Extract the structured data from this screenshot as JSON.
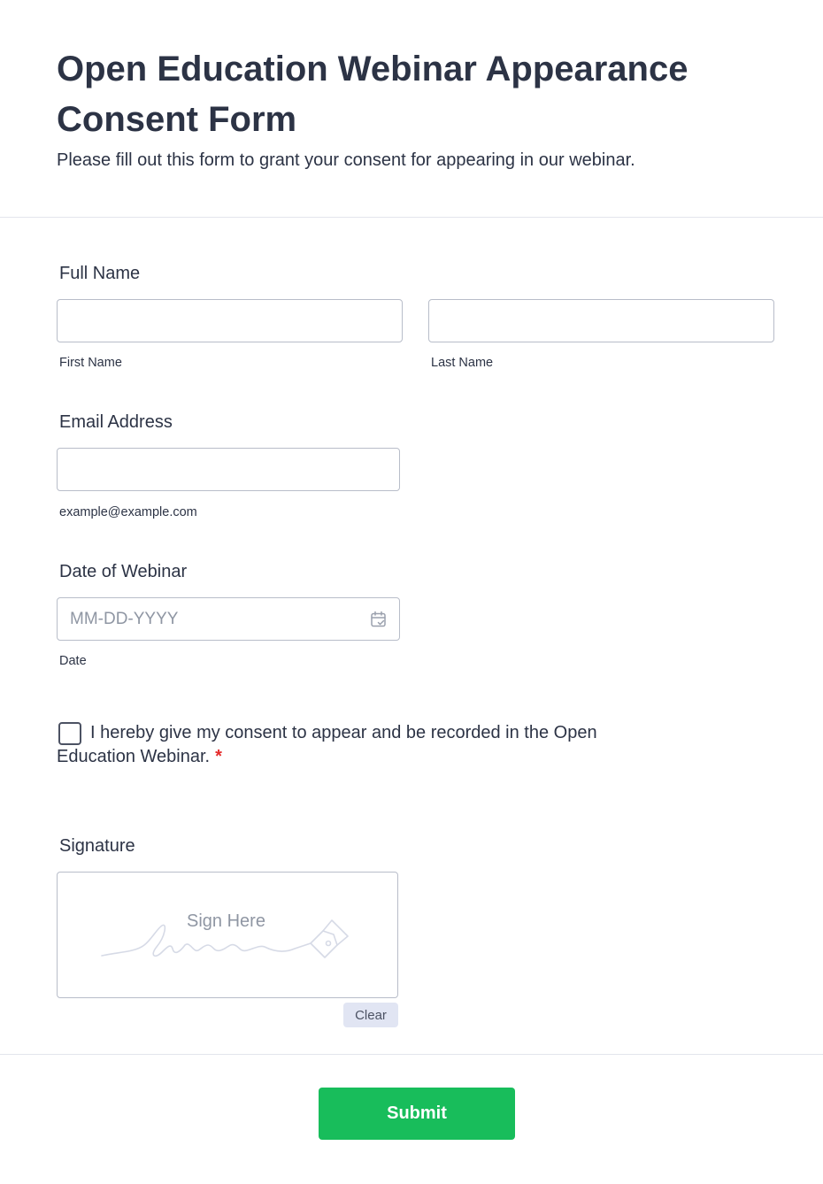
{
  "header": {
    "title": "Open Education Webinar Appearance Consent Form",
    "subtitle": "Please fill out this form to grant your consent for appearing in our webinar."
  },
  "full_name": {
    "label": "Full Name",
    "first": {
      "value": "",
      "sublabel": "First Name"
    },
    "last": {
      "value": "",
      "sublabel": "Last Name"
    }
  },
  "email": {
    "label": "Email Address",
    "value": "",
    "sublabel": "example@example.com"
  },
  "date": {
    "label": "Date of Webinar",
    "value": "",
    "placeholder": "MM-DD-YYYY",
    "sublabel": "Date",
    "icon": "calendar-icon"
  },
  "consent": {
    "checked": false,
    "text": "I hereby give my consent to appear and be recorded in the Open Education Webinar.",
    "required_mark": "*"
  },
  "signature": {
    "label": "Signature",
    "placeholder": "Sign Here",
    "icon": "pen-nib-icon",
    "clear_label": "Clear"
  },
  "submit_label": "Submit",
  "colors": {
    "text": "#2c3345",
    "border": "#b8bdc9",
    "placeholder": "#8f96a3",
    "required": "#e52a2a",
    "submit": "#18bd5b",
    "clear_bg": "#e1e5f3"
  }
}
